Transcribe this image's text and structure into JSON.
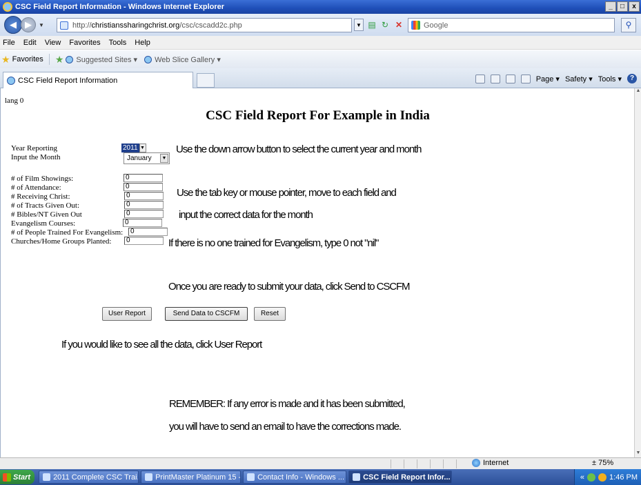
{
  "window": {
    "title": "CSC Field Report Information - Windows Internet Explorer",
    "controls": [
      "_",
      "□",
      "x"
    ]
  },
  "address": {
    "url_prefix": "http://",
    "url_host": "christianssharingchrist.org",
    "url_path": "/csc/cscadd2c.php",
    "search_placeholder": "Google"
  },
  "menu": [
    "File",
    "Edit",
    "View",
    "Favorites",
    "Tools",
    "Help"
  ],
  "favorites": {
    "label": "Favorites",
    "links": [
      "Suggested Sites ▾",
      "Web Slice Gallery ▾"
    ]
  },
  "tab": {
    "title": "CSC Field Report Information",
    "commands": [
      "Page ▾",
      "Safety ▾",
      "Tools ▾"
    ]
  },
  "page": {
    "lang": "lang 0",
    "title": "CSC Field Report For Example in India",
    "year_label": "Year Reporting",
    "year_value": "2011",
    "month_label": "Input the Month",
    "month_value": "January",
    "fields": [
      {
        "label": "# of Film Showings:",
        "value": "0"
      },
      {
        "label": "# of Attendance:",
        "value": "0"
      },
      {
        "label": "# Receiving Christ:",
        "value": "0"
      },
      {
        "label": "# of Tracts Given Out:",
        "value": "0"
      },
      {
        "label": "# Bibles/NT Given Out",
        "value": "0"
      },
      {
        "label": "Evangelism Courses:",
        "value": "0"
      },
      {
        "label": "# of People Trained For Evangelism:",
        "value": "0"
      },
      {
        "label": "Churches/Home Groups Planted:",
        "value": "0"
      }
    ],
    "hints": {
      "select": "Use the down arrow button to select the current year and month",
      "tab1": "Use the tab key or mouse pointer, move to each field and",
      "tab2": "input the correct data for the month",
      "zero": "If there is no one trained for Evangelism, type 0 not \"nil\"",
      "send": "Once you are ready to submit your data, click Send to CSCFM",
      "report": "If you would like to see all the data, click User Report",
      "remember1": "REMEMBER: If any error is made and it has been submitted,",
      "remember2": "you will have to send an email to have the corrections made."
    },
    "buttons": {
      "user_report": "User Report",
      "send": "Send Data to CSCFM",
      "reset": "Reset"
    }
  },
  "status": {
    "zone": "Internet",
    "zoom": "± 75%"
  },
  "taskbar": {
    "start": "Start",
    "tasks": [
      "2011 Complete CSC Trai...",
      "PrintMaster Platinum 15 -...",
      "Contact Info - Windows ...",
      "CSC Field Report Infor..."
    ],
    "clock": "1:46 PM"
  },
  "colors": {
    "titlebar": "#1f4fb8",
    "taskbar": "#2b4f98",
    "start": "#3ea84b",
    "year_select_bg": "#1f3f8c"
  }
}
